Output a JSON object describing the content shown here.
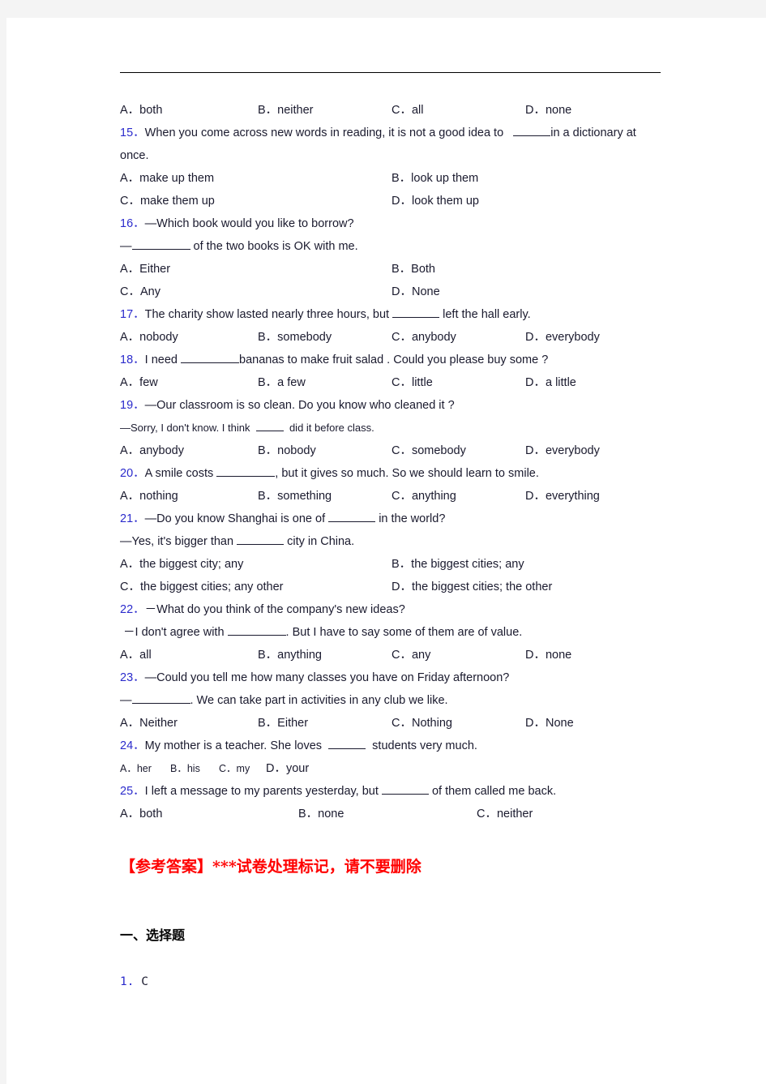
{
  "page": {
    "background": "#f4f4f4",
    "paper": "#ffffff",
    "rule_color": "#000000",
    "number_color": "#2b2bcc",
    "text_color": "#1a1a2e",
    "answer_mark_color": "#ff0000"
  },
  "questions": [
    {
      "id": "q14-options",
      "layout": "four",
      "options": [
        "A．both",
        "B．neither",
        "C．all",
        "D．none"
      ]
    },
    {
      "id": "q15",
      "number": "15．",
      "stem_a": "When you come across new words in reading, it is not a good idea to",
      "stem_b": "in a dictionary at",
      "stem_c": "once.",
      "layout": "two",
      "options": [
        "A．make up them",
        "B．look up them",
        "C．make them up",
        "D．look them up"
      ]
    },
    {
      "id": "q16",
      "number": "16．",
      "stem_a": "—Which book would you like to borrow?",
      "stem_b": "—",
      "stem_c": "of the two books is OK with me.",
      "layout": "two",
      "options": [
        "A．Either",
        "B．Both",
        "C．Any",
        "D．None"
      ]
    },
    {
      "id": "q17",
      "number": "17．",
      "stem_a": "The charity show lasted nearly three hours, but",
      "stem_b": "left the hall early.",
      "layout": "four",
      "options": [
        "A．nobody",
        "B．somebody",
        "C．anybody",
        "D．everybody"
      ]
    },
    {
      "id": "q18",
      "number": "18．",
      "stem_a": "I need",
      "stem_b": "bananas to make fruit salad . Could you please buy some ?",
      "layout": "four",
      "options": [
        "A．few",
        "B．a few",
        "C．little",
        "D．a little"
      ]
    },
    {
      "id": "q19",
      "number": "19．",
      "stem_a": "—Our classroom is so clean. Do you know who cleaned it ?",
      "stem_b": "—Sorry, I don't know. I think",
      "stem_c": "did it before class.",
      "layout": "four",
      "options": [
        "A．anybody",
        "B．nobody",
        "C．somebody",
        "D．everybody"
      ]
    },
    {
      "id": "q20",
      "number": "20．",
      "stem_a": "A smile costs",
      "stem_b": ", but it gives so much. So we should learn to smile.",
      "layout": "four",
      "options": [
        "A．nothing",
        "B．something",
        "C．anything",
        "D．everything"
      ]
    },
    {
      "id": "q21",
      "number": "21．",
      "stem_a": "—Do you know Shanghai is one of",
      "stem_b": "in the world?",
      "stem_c": "—Yes, it's bigger than",
      "stem_d": "city in China.",
      "layout": "two",
      "options": [
        "A．the biggest city; any",
        "B．the biggest cities; any",
        "C．the biggest cities; any other",
        "D．the biggest cities; the other"
      ]
    },
    {
      "id": "q22",
      "number": "22．",
      "stem_a": "－What do you think of the company's new ideas?",
      "stem_b": "－I don't agree with",
      "stem_c": ". But I have to say some of them are of value.",
      "layout": "four",
      "options": [
        "A．all",
        "B．anything",
        "C．any",
        "D．none"
      ]
    },
    {
      "id": "q23",
      "number": "23．",
      "stem_a": "—Could you tell me how many classes you have on Friday afternoon?",
      "stem_b": "—",
      "stem_c": ". We can take part in activities in any club we like.",
      "layout": "four",
      "options": [
        "A．Neither",
        "B．Either",
        "C．Nothing",
        "D．None"
      ]
    },
    {
      "id": "q24",
      "number": "24．",
      "stem_a": "My mother is a teacher. She loves",
      "stem_b": "students very much.",
      "layout": "inline",
      "options": [
        "A．her",
        "B．his",
        "C．my",
        "D．your"
      ]
    },
    {
      "id": "q25",
      "number": "25．",
      "stem_a": "I left a message to my parents yesterday, but",
      "stem_b": "of them called me back.",
      "layout": "three",
      "options": [
        "A．both",
        "B．none",
        "C．neither"
      ]
    }
  ],
  "answer_section": {
    "mark": "【参考答案】***试卷处理标记，请不要删除",
    "heading": "一、选择题",
    "items": [
      {
        "number": "1.",
        "value": "C"
      }
    ]
  }
}
